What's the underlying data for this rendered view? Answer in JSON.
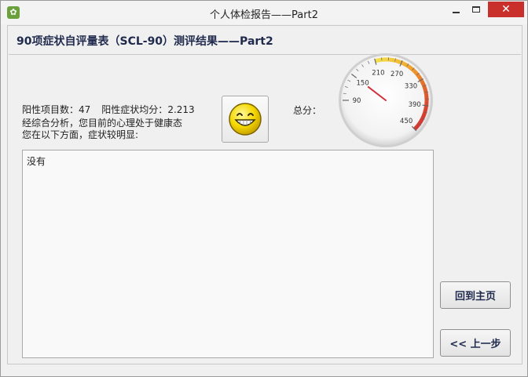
{
  "window": {
    "title": "个人体检报告——Part2",
    "close_glyph": "✕"
  },
  "header": {
    "title": "90项症状自评量表（SCL-90）测评结果——Part2"
  },
  "summary": {
    "positive_count_label": "阳性项目数：",
    "positive_count": "47",
    "positive_avg_label": "阳性症状均分：",
    "positive_avg": "2.213",
    "analysis_text": "经综合分析，您目前的心理处于健康态",
    "symptom_intro": "您在以下方面，症状较明显:",
    "total_label": "总分："
  },
  "mood_icon": "smiley-face-icon",
  "gauge": {
    "min": 90,
    "max": 450,
    "ticks": [
      "90",
      "150",
      "210",
      "270",
      "330",
      "390",
      "450"
    ],
    "value": 150,
    "colors": {
      "needle": "#d0333f",
      "arc_start": "#f4e44a",
      "arc_end": "#cc2233"
    }
  },
  "result": {
    "text": "没有"
  },
  "buttons": {
    "home": "回到主页",
    "prev": "<< 上一步"
  }
}
